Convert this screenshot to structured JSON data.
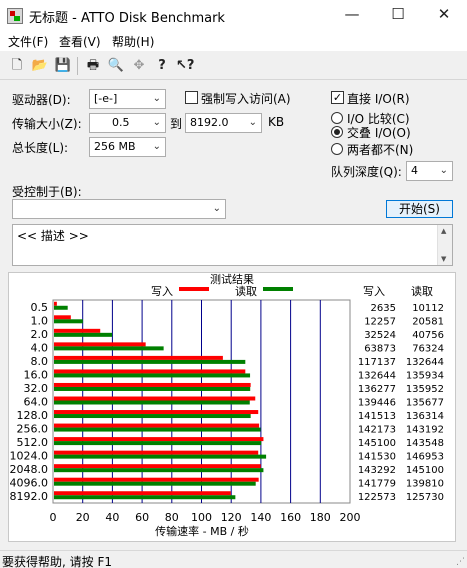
{
  "window": {
    "title": "无标题 - ATTO Disk Benchmark",
    "minimize": "—",
    "maximize": "☐",
    "close": "✕"
  },
  "menu": [
    "文件(F)",
    "查看(V)",
    "帮助(H)"
  ],
  "toolbar_icons": [
    "new-file-icon",
    "open-folder-icon",
    "save-icon",
    "print-icon",
    "print-preview-icon",
    "move-icon",
    "help-icon",
    "context-help-icon"
  ],
  "toolbar_glyphs": [
    "🗋",
    "📂",
    "💾",
    "🖶",
    "🔍",
    "✥",
    "?",
    "↖?"
  ],
  "form": {
    "drive_label": "驱动器(D):",
    "drive_value": "[-e-]",
    "force_write_label": "强制写入访问(A)",
    "force_write_checked": false,
    "direct_io_label": "直接 I/O(R)",
    "direct_io_checked": true,
    "transfer_label": "传输大小(Z):",
    "transfer_from": "0.5",
    "to_label": "到",
    "transfer_to": "8192.0",
    "kb_label": "KB",
    "length_label": "总长度(L):",
    "length_value": "256 MB",
    "io_compare_label": "I/O 比较(C)",
    "overlapped_label": "交叠 I/O(O)",
    "neither_label": "两者都不(N)",
    "io_mode_selected": "交叠 I/O(O)",
    "queue_label": "队列深度(Q):",
    "queue_value": "4",
    "controlled_label": "受控制于(B):",
    "controlled_value": "",
    "start_label": "开始(S)",
    "description": "<< 描述 >>"
  },
  "results": {
    "title": "测试结果",
    "write_legend": "写入",
    "read_legend": "读取",
    "col_write": "写入",
    "col_read": "读取",
    "rows": [
      {
        "size": "0.5",
        "write": "2635",
        "read": "10112"
      },
      {
        "size": "1.0",
        "write": "12257",
        "read": "20581"
      },
      {
        "size": "2.0",
        "write": "32524",
        "read": "40756"
      },
      {
        "size": "4.0",
        "write": "63873",
        "read": "76324"
      },
      {
        "size": "8.0",
        "write": "117137",
        "read": "132644"
      },
      {
        "size": "16.0",
        "write": "132644",
        "read": "135934"
      },
      {
        "size": "32.0",
        "write": "136277",
        "read": "135952"
      },
      {
        "size": "64.0",
        "write": "139446",
        "read": "135677"
      },
      {
        "size": "128.0",
        "write": "141513",
        "read": "136314"
      },
      {
        "size": "256.0",
        "write": "142173",
        "read": "143192"
      },
      {
        "size": "512.0",
        "write": "145100",
        "read": "143548"
      },
      {
        "size": "1024.0",
        "write": "141530",
        "read": "146953"
      },
      {
        "size": "2048.0",
        "write": "143292",
        "read": "145100"
      },
      {
        "size": "4096.0",
        "write": "141779",
        "read": "139810"
      },
      {
        "size": "8192.0",
        "write": "122573",
        "read": "125730"
      }
    ]
  },
  "chart_data": {
    "type": "bar",
    "orientation": "horizontal",
    "title": "测试结果",
    "xlabel": "传输速率 - MB / 秒",
    "ylabel": "",
    "xlim": [
      0,
      200
    ],
    "xticks": [
      "0",
      "20",
      "40",
      "60",
      "80",
      "100",
      "120",
      "140",
      "160",
      "180",
      "200"
    ],
    "categories": [
      "0.5",
      "1.0",
      "2.0",
      "4.0",
      "8.0",
      "16.0",
      "32.0",
      "64.0",
      "128.0",
      "256.0",
      "512.0",
      "1024.0",
      "2048.0",
      "4096.0",
      "8192.0"
    ],
    "series": [
      {
        "name": "写入",
        "color": "#ff0000",
        "values": [
          2.6,
          12.0,
          31.8,
          62.4,
          114.4,
          129.5,
          133.1,
          136.2,
          138.2,
          138.8,
          141.7,
          138.2,
          139.9,
          138.5,
          119.7
        ]
      },
      {
        "name": "读取",
        "color": "#008000",
        "values": [
          9.9,
          20.1,
          39.8,
          74.5,
          129.5,
          132.7,
          132.8,
          132.5,
          133.1,
          139.8,
          140.2,
          143.5,
          141.7,
          136.5,
          122.8
        ]
      }
    ],
    "grid": true,
    "legend": "top"
  },
  "status": "要获得帮助, 请按 F1"
}
